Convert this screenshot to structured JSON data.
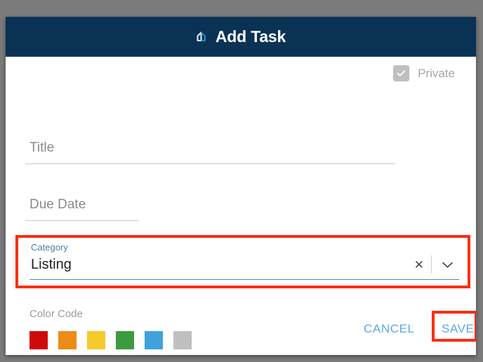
{
  "dialog": {
    "header": {
      "title": "Add Task",
      "icon": "home-icon",
      "background_color": "#0a3255"
    },
    "private": {
      "label": "Private",
      "checked": true,
      "icon": "check-icon",
      "checkbox_color": "#bfbfbf"
    },
    "fields": [
      {
        "name": "title",
        "placeholder": "Title",
        "value": ""
      },
      {
        "name": "due_date",
        "placeholder": "Due Date",
        "value": ""
      }
    ],
    "category": {
      "label": "Category",
      "value": "Listing",
      "clear_icon": "✕",
      "dropdown_icon": "chevron-down-icon",
      "label_color": "#4d7d9e",
      "underline_color": "#5d87a5"
    },
    "color_code": {
      "label": "Color Code",
      "swatches": [
        {
          "name": "red",
          "hex": "#cf0a0a"
        },
        {
          "name": "orange",
          "hex": "#ec8b16"
        },
        {
          "name": "yellow",
          "hex": "#f4cb2b"
        },
        {
          "name": "green",
          "hex": "#3c9b3f"
        },
        {
          "name": "blue",
          "hex": "#3fa2dd"
        },
        {
          "name": "gray",
          "hex": "#bfbfbf"
        }
      ]
    },
    "footer": {
      "cancel_label": "CANCEL",
      "save_label": "SAVE",
      "action_color": "#5ea9dd"
    },
    "annotations": {
      "highlight_color": "#fc2d12",
      "highlighted_regions": [
        "category-field",
        "save-button"
      ]
    }
  }
}
